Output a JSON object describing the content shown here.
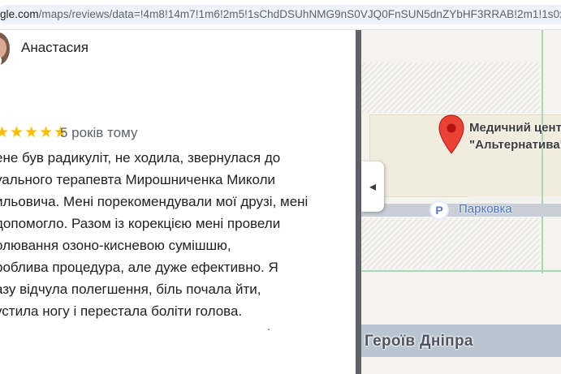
{
  "browser": {
    "url_host": "gle.com",
    "url_path": "/maps/reviews/data=!4m8!14m7!1m6!2m5!1sChdDSUhNMG9nS0VJQ0FnSUN5dnZYbHF3RRAB!2m1!1s0x"
  },
  "review": {
    "author": "Анастасия",
    "rating": 5,
    "stars": "★★★★★",
    "date": "5 років тому",
    "lines": [
      "ене був радикуліт, не ходила, звернулася до",
      "уального терапевта Мирошниченка Миколи",
      "ильовича. Мені порекомендували мої друзі, мені",
      "допомогло. Разом із корекцією мені провели",
      "олювання озоно-кисневою сумішшю,",
      "роблива процедура, але дуже ефективно. Я",
      "азу відчула полегшення, біль почала йти,",
      "устила ногу і перестала боліти голова."
    ]
  },
  "panel": {
    "collapse_icon": "chevron-left-icon",
    "collapse_glyph": "◂"
  },
  "map": {
    "place_name_line1": "Медичний цент",
    "place_name_line2": "\"Альтернатива\"",
    "parking_glyph": "P",
    "parking_label": "Парковка",
    "road_name": "Героїв Дніпра",
    "pin_color": "#ea4335"
  }
}
